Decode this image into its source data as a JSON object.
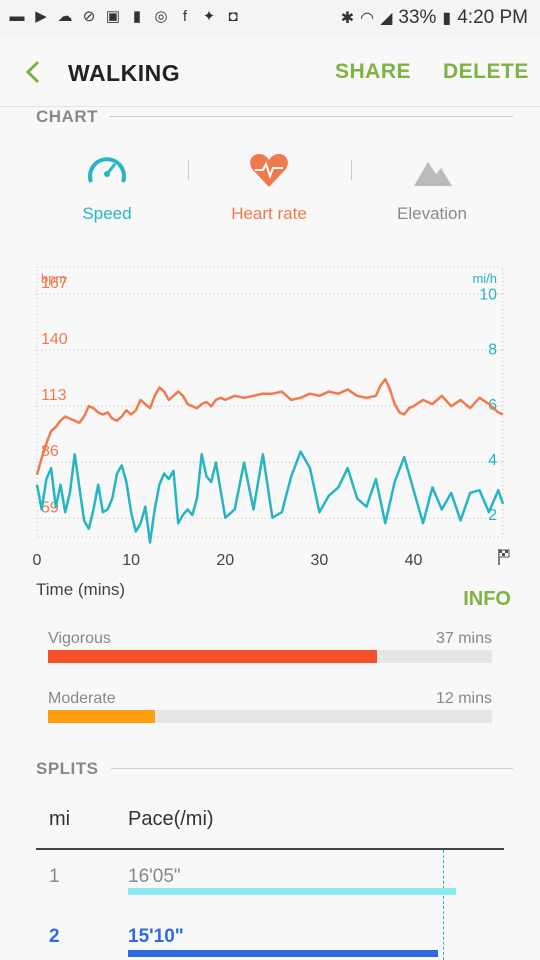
{
  "status_bar": {
    "left_icons": [
      "messages-icon",
      "play-store-icon",
      "cloud-icon",
      "mute-icon",
      "image-icon",
      "tablet-icon",
      "sync-icon",
      "facebook-icon",
      "twitter-icon",
      "instagram-icon"
    ],
    "battery_percent": "33%",
    "time": "4:20 PM"
  },
  "header": {
    "title": "WALKING",
    "share_label": "SHARE",
    "delete_label": "DELETE",
    "accent_color": "#7cb342"
  },
  "chart_section": {
    "heading": "CHART",
    "tabs": [
      {
        "label": "Speed",
        "icon": "speedometer-icon",
        "color": "#26b5c2"
      },
      {
        "label": "Heart rate",
        "icon": "heart-rate-icon",
        "color": "#f07a4e"
      },
      {
        "label": "Elevation",
        "icon": "mountain-icon",
        "color": "#888888"
      }
    ]
  },
  "chart_data": {
    "type": "line",
    "xlabel": "Time (mins)",
    "x_ticks": [
      "0",
      "10",
      "20",
      "30",
      "40"
    ],
    "x_end_icon": "finish-flag-icon",
    "xlim": [
      0,
      49.5
    ],
    "left_axis": {
      "unit": "bpm",
      "ticks": [
        "167",
        "140",
        "113",
        "86",
        "59"
      ],
      "ylim": [
        50,
        180
      ],
      "color": "#f07a4e"
    },
    "right_axis": {
      "unit": "mi/h",
      "ticks": [
        "10",
        "8",
        "6",
        "4",
        "2"
      ],
      "ylim": [
        1.6,
        11.4
      ],
      "color": "#26b5c2"
    },
    "grid": "dotted",
    "series": [
      {
        "name": "Heart rate",
        "axis": "left",
        "color": "#f07a4e",
        "x": [
          0,
          0.5,
          1,
          1.5,
          2,
          2.5,
          3,
          3.5,
          4,
          4.5,
          5,
          5.5,
          6,
          6.5,
          7,
          7.5,
          8,
          8.5,
          9,
          9.5,
          10,
          10.5,
          11,
          11.5,
          12,
          12.5,
          13,
          13.5,
          14,
          14.5,
          15,
          15.5,
          16,
          16.5,
          17,
          17.5,
          18,
          18.5,
          19,
          19.5,
          20,
          21,
          22,
          23,
          24,
          25,
          26,
          27,
          28,
          29,
          30,
          31,
          32,
          33,
          34,
          35,
          36,
          36.5,
          37,
          37.5,
          38,
          38.5,
          39,
          39.5,
          40,
          41,
          42,
          43,
          44,
          45,
          46,
          47,
          48,
          49,
          49.5
        ],
        "values": [
          80,
          88,
          95,
          101,
          103,
          106,
          108,
          107,
          106,
          105,
          108,
          113,
          112,
          110,
          109,
          110,
          107,
          106,
          108,
          111,
          109,
          111,
          116,
          114,
          112,
          118,
          122,
          120,
          116,
          118,
          120,
          118,
          114,
          113,
          112,
          114,
          115,
          113,
          116,
          117,
          116,
          118,
          117,
          118,
          119,
          119,
          120,
          116,
          117,
          119,
          118,
          120,
          119,
          121,
          118,
          117,
          118,
          123,
          126,
          121,
          114,
          110,
          109,
          112,
          113,
          116,
          114,
          118,
          113,
          116,
          112,
          117,
          114,
          110,
          109
        ]
      },
      {
        "name": "Speed",
        "axis": "right",
        "color": "#26b5c2",
        "x": [
          0,
          0.5,
          1,
          1.5,
          2,
          2.5,
          3,
          3.5,
          4,
          4.5,
          5,
          5.5,
          6,
          6.5,
          7,
          7.5,
          8,
          8.5,
          9,
          9.5,
          10,
          10.5,
          11,
          11.5,
          12,
          12.5,
          13,
          13.5,
          14,
          14.5,
          15,
          15.5,
          16,
          16.5,
          17,
          17.5,
          18,
          18.5,
          19,
          19.5,
          20,
          21,
          22,
          23,
          24,
          25,
          26,
          27,
          28,
          29,
          30,
          31,
          32,
          33,
          34,
          35,
          36,
          37,
          38,
          39,
          40,
          41,
          42,
          43,
          44,
          45,
          46,
          47,
          48,
          49,
          49.5
        ],
        "values": [
          3.5,
          2.6,
          3.7,
          4.1,
          2.7,
          3.5,
          2.5,
          3.2,
          4.6,
          3.4,
          2.2,
          1.9,
          2.6,
          3.5,
          2.5,
          2.6,
          3.0,
          3.9,
          4.2,
          3.6,
          2.5,
          1.8,
          2.1,
          2.7,
          1.4,
          2.6,
          3.5,
          3.9,
          3.7,
          4.0,
          2.1,
          2.4,
          2.6,
          2.4,
          3.0,
          4.6,
          3.8,
          3.6,
          4.3,
          3.3,
          2.3,
          2.6,
          4.3,
          2.6,
          4.6,
          2.3,
          2.5,
          3.8,
          4.7,
          4.1,
          2.5,
          3.1,
          3.4,
          4.1,
          3.0,
          2.7,
          3.7,
          2.1,
          3.6,
          4.5,
          3.3,
          2.1,
          3.4,
          2.6,
          3.2,
          2.2,
          3.2,
          3.3,
          2.5,
          3.3,
          2.8
        ]
      }
    ]
  },
  "time_axis_label": "Time (mins)",
  "info": {
    "button_label": "INFO",
    "rows": [
      {
        "label": "Vigorous",
        "value": "37 mins",
        "fraction": 0.74,
        "color": "#f4502a"
      },
      {
        "label": "Moderate",
        "value": "12 mins",
        "fraction": 0.24,
        "color": "#ff9f10"
      }
    ]
  },
  "splits": {
    "heading": "SPLITS",
    "col_mi": "mi",
    "col_pace": "Pace(/mi)",
    "rows": [
      {
        "mi": "1",
        "pace": "16'05\"",
        "bar_fraction": 0.92,
        "color": "#8be9ee",
        "text_color": "#888888",
        "highlight": false
      },
      {
        "mi": "2",
        "pace": "15'10\"",
        "bar_fraction": 0.87,
        "color": "#2f6be0",
        "text_color": "#2f6be0",
        "highlight": true
      }
    ]
  }
}
